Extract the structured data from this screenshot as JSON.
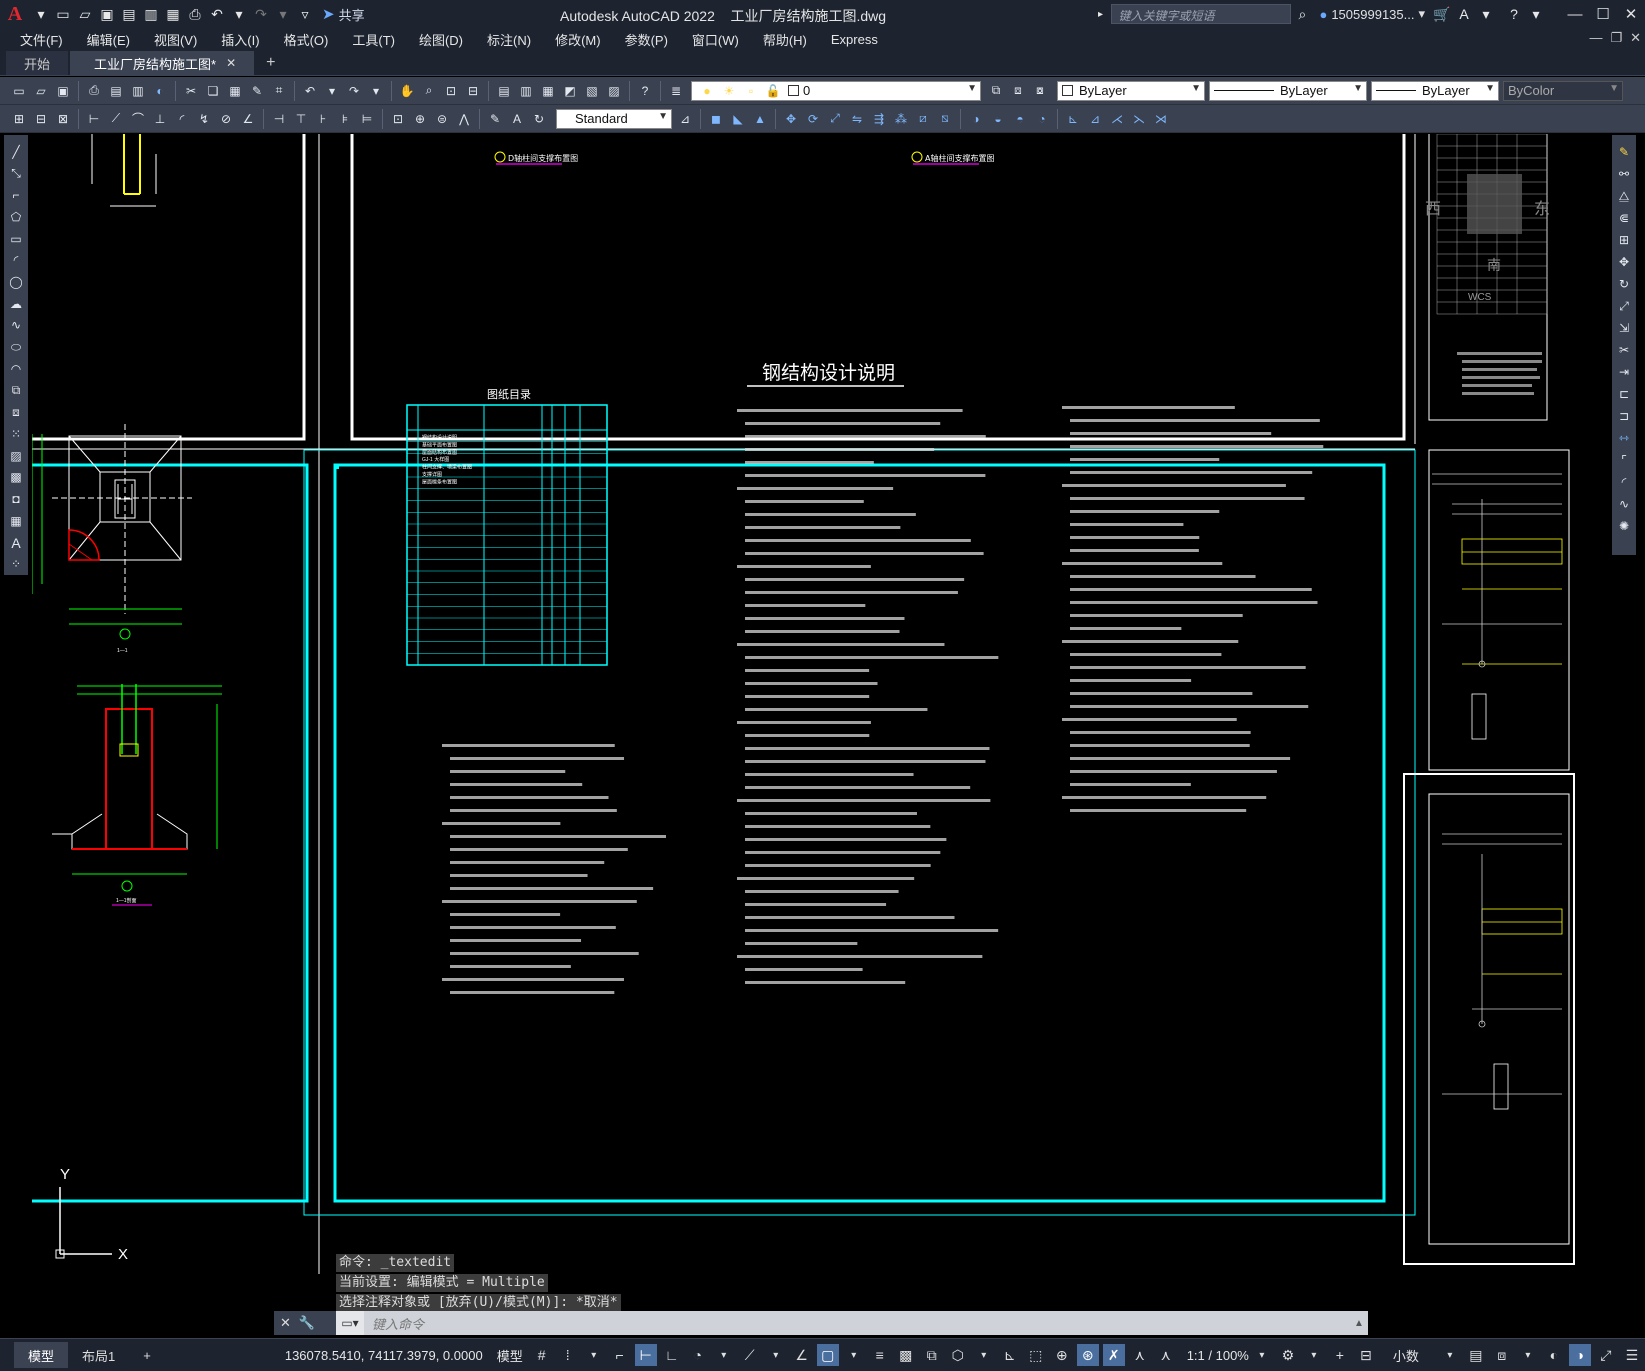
{
  "title_bar": {
    "app_title": "Autodesk AutoCAD 2022",
    "file_name": "工业厂房结构施工图.dwg",
    "share_label": "共享",
    "search_placeholder": "键入关键字或短语",
    "user_name": "1505999135...",
    "quick_access_icons": [
      "new-icon",
      "open-icon",
      "save-icon",
      "save-as-icon",
      "publish-icon",
      "import-icon",
      "print-icon",
      "undo-icon",
      "redo-icon",
      "more-icon"
    ]
  },
  "menu": {
    "items": [
      "文件(F)",
      "编辑(E)",
      "视图(V)",
      "插入(I)",
      "格式(O)",
      "工具(T)",
      "绘图(D)",
      "标注(N)",
      "修改(M)",
      "参数(P)",
      "窗口(W)",
      "帮助(H)",
      "Express"
    ]
  },
  "tabs": {
    "items": [
      {
        "label": "开始",
        "active": false
      },
      {
        "label": "工业厂房结构施工图*",
        "active": true
      }
    ]
  },
  "toolbar1": {
    "layer_name": "0",
    "color": "ByLayer",
    "linetype": "ByLayer",
    "lineweight": "ByLayer",
    "plot_style": "ByColor"
  },
  "toolbar2": {
    "text_style": "Standard"
  },
  "drawing": {
    "top_left_label_d": "D轴柱间支撑布置图",
    "top_left_label_a": "A轴柱间支撑布置图",
    "main_title": "钢结构设计说明",
    "drawing_index_title": "图纸目录",
    "section_label_1": "1—1",
    "section_label_2": "1—1剖面",
    "compass": {
      "west": "西",
      "east": "东",
      "south": "南",
      "wcs": "WCS"
    },
    "index_rows": [
      "钢结构设计说明",
      "基础平面布置图",
      "屋面结构布置图",
      "GJ-1 大样图",
      "柱间支撑、墙梁布置图",
      "支撑详图",
      "屋面檩条布置图"
    ]
  },
  "ucs": {
    "x": "X",
    "y": "Y"
  },
  "command": {
    "history": [
      "命令: _textedit",
      "当前设置: 编辑模式 = Multiple",
      "选择注释对象或 [放弃(U)/模式(M)]: *取消*"
    ],
    "placeholder": "键入命令"
  },
  "status_bar": {
    "layout_tabs": [
      {
        "label": "模型",
        "active": true
      },
      {
        "label": "布局1",
        "active": false
      }
    ],
    "coordinates": "136078.5410, 74117.3979, 0.0000",
    "space": "模型",
    "scale": "1:1 / 100%",
    "units": "小数"
  }
}
